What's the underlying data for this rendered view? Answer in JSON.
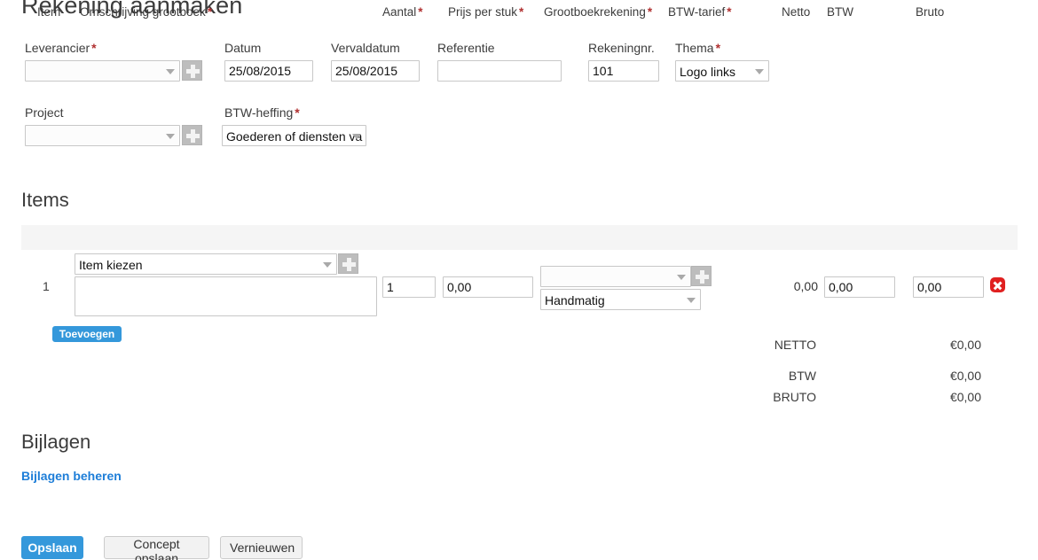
{
  "page": {
    "title": "Rekening aanmaken"
  },
  "header_fields": {
    "leverancier": {
      "label": "Leverancier",
      "required": true,
      "value": "",
      "add_icon": "plus-icon"
    },
    "datum": {
      "label": "Datum",
      "required": false,
      "value": "25/08/2015"
    },
    "vervaldatum": {
      "label": "Vervaldatum",
      "required": false,
      "value": "25/08/2015"
    },
    "referentie": {
      "label": "Referentie",
      "required": false,
      "value": ""
    },
    "rekeningnr": {
      "label": "Rekeningnr.",
      "required": false,
      "value": "101"
    },
    "thema": {
      "label": "Thema",
      "required": true,
      "value": "Logo links"
    },
    "project": {
      "label": "Project",
      "required": false,
      "value": "",
      "add_icon": "plus-icon"
    },
    "btw_heffing": {
      "label": "BTW-heffing",
      "required": true,
      "value": "Goederen of diensten va"
    }
  },
  "items": {
    "section_title": "Items",
    "columns": [
      {
        "label": "Item",
        "required": false
      },
      {
        "label": "Omschrijving grootboek",
        "required": true
      },
      {
        "label": "Aantal",
        "required": true
      },
      {
        "label": "Prijs per stuk",
        "required": true
      },
      {
        "label": "Grootboekrekening",
        "required": true
      },
      {
        "label": "BTW-tarief",
        "required": true
      },
      {
        "label": "Netto",
        "required": false
      },
      {
        "label": "BTW",
        "required": false
      },
      {
        "label": "Bruto",
        "required": false
      }
    ],
    "rows": [
      {
        "number": "1",
        "item_select": "Item kiezen",
        "description": "",
        "aantal": "1",
        "prijs_per_stuk": "0,00",
        "grootboekrekening": "",
        "btw_tarief": "Handmatig",
        "netto": "0,00",
        "btw": "0,00",
        "bruto": "0,00",
        "delete_icon": "delete-icon"
      }
    ],
    "add_button_label": "Toevoegen"
  },
  "totals": [
    {
      "label": "NETTO",
      "value": "€0,00"
    },
    {
      "label": "BTW",
      "value": "€0,00"
    },
    {
      "label": "BRUTO",
      "value": "€0,00"
    }
  ],
  "attachments": {
    "section_title": "Bijlagen",
    "manage_link": "Bijlagen beheren"
  },
  "actions": {
    "save": "Opslaan",
    "save_draft": "Concept opslaan",
    "refresh": "Vernieuwen"
  },
  "colors": {
    "primary_blue": "#3498db",
    "link_blue": "#1e7ed8",
    "required_red": "#b03030",
    "delete_red": "#e02020",
    "table_header_bg": "#f5f5f5"
  }
}
